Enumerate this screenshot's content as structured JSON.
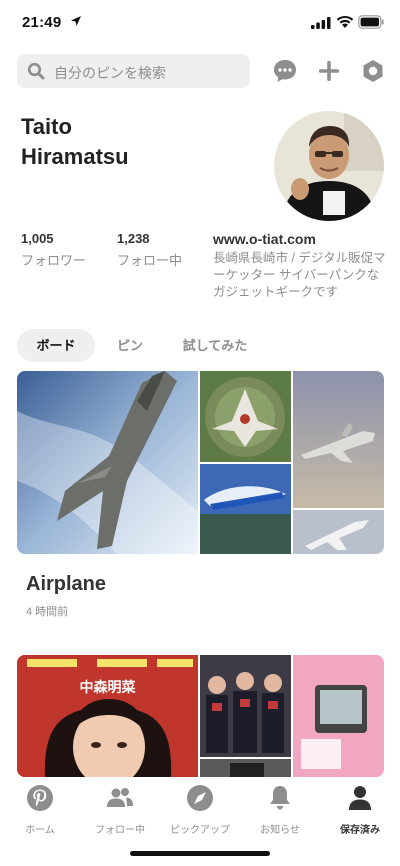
{
  "status_bar": {
    "time": "21:49"
  },
  "search": {
    "placeholder": "自分のピンを検索"
  },
  "header_icons": [
    "messages-icon",
    "plus-icon",
    "settings-icon"
  ],
  "profile": {
    "name_line1": "Taito",
    "name_line2": "Hiramatsu",
    "followers_count": "1,005",
    "followers_label": "フォロワー",
    "following_count": "1,238",
    "following_label": "フォロー中",
    "website": "www.o-tiat.com",
    "bio": "長崎県長崎市 / デジタル販促マーケッター サイバーパンクなガジェットギークです"
  },
  "tabs": [
    {
      "label": "ボード",
      "active": true
    },
    {
      "label": "ピン",
      "active": false
    },
    {
      "label": "試してみた",
      "active": false
    }
  ],
  "boards": [
    {
      "title": "Airplane",
      "updated": "4 時間前"
    },
    {
      "title": "",
      "updated": "",
      "cover_text": "中森明菜"
    }
  ],
  "bottom_nav": [
    {
      "label": "ホーム",
      "icon": "pinterest-icon",
      "active": false
    },
    {
      "label": "フォロー中",
      "icon": "people-icon",
      "active": false
    },
    {
      "label": "ピックアップ",
      "icon": "compass-icon",
      "active": false
    },
    {
      "label": "お知らせ",
      "icon": "bell-icon",
      "active": false
    },
    {
      "label": "保存済み",
      "icon": "person-icon",
      "active": true
    }
  ],
  "colors": {
    "accent": "#e60023",
    "text": "#333333",
    "muted": "#8e8e8e",
    "chip": "#efefef"
  }
}
